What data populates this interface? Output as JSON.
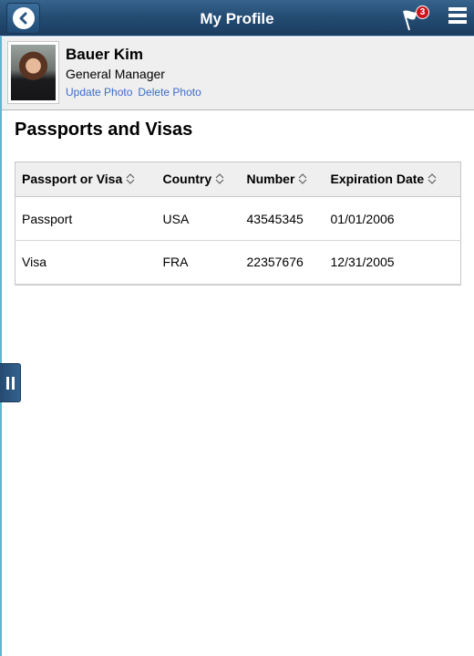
{
  "banner": {
    "title": "My Profile",
    "back_icon": "chevron-left-icon",
    "notifications": {
      "icon": "flag-icon",
      "count": "3",
      "badge_color": "#d0121a"
    },
    "menu_icon": "hamburger-menu-icon"
  },
  "profile": {
    "name": "Bauer Kim",
    "title": "General Manager",
    "update_photo_label": "Update Photo",
    "delete_photo_label": "Delete Photo"
  },
  "section": {
    "title": "Passports and Visas"
  },
  "table": {
    "columns": [
      {
        "label": "Passport or Visa",
        "sort_icon": "sort-icon"
      },
      {
        "label": "Country",
        "sort_icon": "sort-icon"
      },
      {
        "label": "Number",
        "sort_icon": "sort-icon"
      },
      {
        "label": "Expiration Date",
        "sort_icon": "sort-icon"
      }
    ],
    "rows": [
      [
        "Passport",
        "USA",
        "43545345",
        "01/01/2006"
      ],
      [
        "Visa",
        "FRA",
        "22357676",
        "12/31/2005"
      ]
    ]
  },
  "side_panel": {
    "icon": "pause-handle-icon"
  },
  "colors": {
    "banner": "#254d74",
    "link": "#3d6cc9",
    "rail": "#5bb8d0"
  }
}
